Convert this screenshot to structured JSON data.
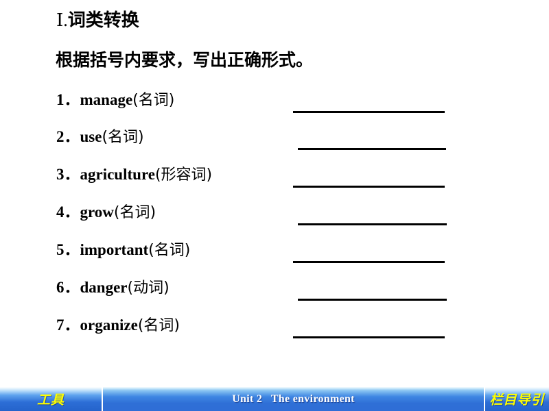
{
  "slide": {
    "background_color": "#ffffff"
  },
  "header": {
    "numeral": "Ⅰ",
    "dot": ".",
    "title_cn": "词类转换",
    "instruction": "根据括号内要求，写出正确形式。"
  },
  "exercise": {
    "items": [
      {
        "number": "1．",
        "word": "manage",
        "pos": "(名词)",
        "answer": ""
      },
      {
        "number": "2．",
        "word": "use",
        "pos": "(名词)",
        "answer": ""
      },
      {
        "number": "3．",
        "word": "agriculture",
        "pos": "(形容词)",
        "answer": ""
      },
      {
        "number": "4．",
        "word": "grow",
        "pos": "(名词)",
        "answer": ""
      },
      {
        "number": "5．",
        "word": "important",
        "pos": "(名词)",
        "answer": ""
      },
      {
        "number": "6．",
        "word": "danger",
        "pos": "(动词)",
        "answer": ""
      },
      {
        "number": "7．",
        "word": "organize",
        "pos": "(名词)",
        "answer": ""
      }
    ]
  },
  "footer": {
    "left_button_label": "工具",
    "center_title": "Unit 2   The environment",
    "right_button_label": "栏目导引",
    "accent_color": "#2f6ed6",
    "label_color": "#ffff00",
    "title_color": "#ffffff"
  }
}
